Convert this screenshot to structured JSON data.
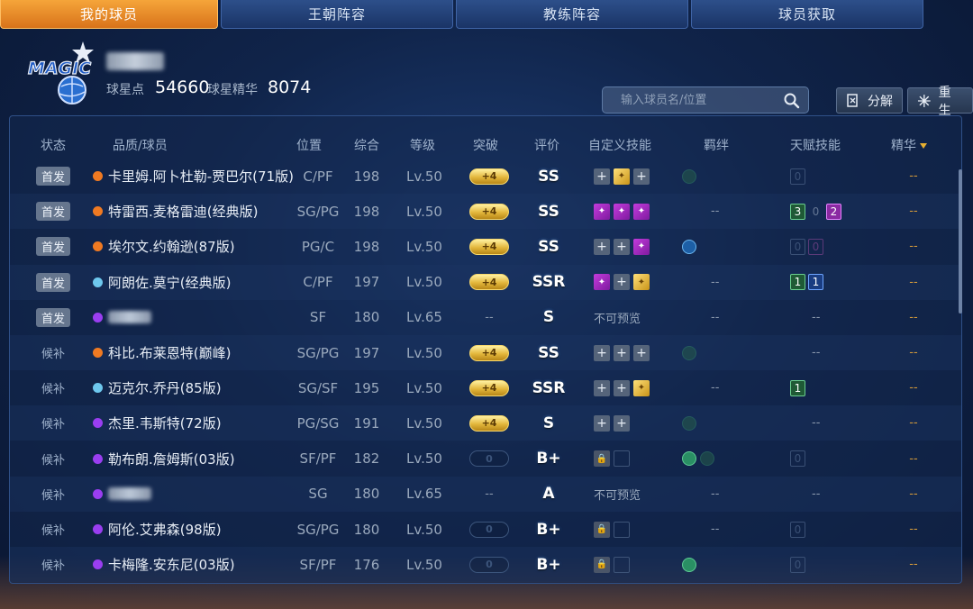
{
  "tabs": [
    "我的球员",
    "王朝阵容",
    "教练阵容",
    "球员获取"
  ],
  "profile": {
    "logo_text": "MAGIC",
    "star_points_label": "球星点",
    "star_points_value": "54660",
    "star_essence_label": "球星精华",
    "star_essence_value": "8074"
  },
  "search": {
    "placeholder": "输入球员名/位置",
    "icon": "search-icon"
  },
  "buttons": {
    "decompose": "分解",
    "rebirth": "重生"
  },
  "columns": [
    "状态",
    "品质/球员",
    "位置",
    "综合",
    "等级",
    "突破",
    "评价",
    "自定义技能",
    "羁绊",
    "天赋技能",
    "精华"
  ],
  "colors": {
    "orange": "#f07a22",
    "light_blue": "#6ec8ee",
    "purple": "#9a3ef0",
    "accent": "#e9962c"
  },
  "rows": [
    {
      "status": "首发",
      "starter": true,
      "quality": "orange",
      "name": "卡里姆.阿卜杜勒-贾巴尔(71版)",
      "position": "C/PF",
      "overall": "198",
      "level": "Lv.50",
      "breakthrough": "+4",
      "rating": "SS",
      "skills": [
        "plus",
        "skill-gold",
        "plus"
      ],
      "bonds": [
        "dim"
      ],
      "talents": [
        {
          "t": "empty",
          "v": "0"
        }
      ],
      "essence": "--"
    },
    {
      "status": "首发",
      "starter": true,
      "quality": "orange",
      "name": "特雷西.麦格雷迪(经典版)",
      "position": "SG/PG",
      "overall": "198",
      "level": "Lv.50",
      "breakthrough": "+4",
      "rating": "SS",
      "skills": [
        "skill-purple",
        "skill-purple",
        "skill-purple"
      ],
      "bonds": [],
      "bond_text": "--",
      "talents": [
        {
          "t": "green",
          "v": "3"
        },
        {
          "t": "plain",
          "v": "0"
        },
        {
          "t": "purple",
          "v": "2"
        }
      ],
      "essence": "--"
    },
    {
      "status": "首发",
      "starter": true,
      "quality": "orange",
      "name": "埃尔文.约翰逊(87版)",
      "position": "PG/C",
      "overall": "198",
      "level": "Lv.50",
      "breakthrough": "+4",
      "rating": "SS",
      "skills": [
        "plus",
        "plus",
        "skill-purple"
      ],
      "bonds": [
        "blue"
      ],
      "talents": [
        {
          "t": "empty",
          "v": "0"
        },
        {
          "t": "empty-purple",
          "v": "0"
        }
      ],
      "essence": "--"
    },
    {
      "status": "首发",
      "starter": true,
      "quality": "light_blue",
      "name": "阿朗佐.莫宁(经典版)",
      "position": "C/PF",
      "overall": "197",
      "level": "Lv.50",
      "breakthrough": "+4",
      "rating": "SSR",
      "skills": [
        "skill-purple",
        "plus",
        "skill-gold"
      ],
      "bonds": [],
      "bond_text": "--",
      "talents": [
        {
          "t": "green",
          "v": "1"
        },
        {
          "t": "blue",
          "v": "1"
        }
      ],
      "essence": "--"
    },
    {
      "status": "首发",
      "starter": true,
      "quality": "purple",
      "name": "",
      "blurred": true,
      "position": "SF",
      "overall": "180",
      "level": "Lv.65",
      "breakthrough": "",
      "bt_text": "--",
      "rating": "S",
      "skills": [],
      "skills_text": "不可预览",
      "bonds": [],
      "bond_text": "--",
      "talents": [],
      "talent_text": "--",
      "essence": "--"
    },
    {
      "status": "候补",
      "starter": false,
      "quality": "orange",
      "name": "科比.布莱恩特(巅峰)",
      "position": "SG/PG",
      "overall": "197",
      "level": "Lv.50",
      "breakthrough": "+4",
      "rating": "SS",
      "skills": [
        "plus",
        "plus",
        "plus"
      ],
      "bonds": [
        "dim"
      ],
      "talents": [],
      "talent_text": "--",
      "essence": "--"
    },
    {
      "status": "候补",
      "starter": false,
      "quality": "light_blue",
      "name": "迈克尔.乔丹(85版)",
      "position": "SG/SF",
      "overall": "195",
      "level": "Lv.50",
      "breakthrough": "+4",
      "rating": "SSR",
      "skills": [
        "plus",
        "plus",
        "skill-gold"
      ],
      "bonds": [],
      "bond_text": "--",
      "talents": [
        {
          "t": "green",
          "v": "1"
        }
      ],
      "essence": "--"
    },
    {
      "status": "候补",
      "starter": false,
      "quality": "purple",
      "name": "杰里.韦斯特(72版)",
      "position": "PG/SG",
      "overall": "191",
      "level": "Lv.50",
      "breakthrough": "+4",
      "rating": "S",
      "skills": [
        "plus",
        "plus"
      ],
      "bonds": [
        "dim"
      ],
      "talents": [],
      "talent_text": "--",
      "essence": "--"
    },
    {
      "status": "候补",
      "starter": false,
      "quality": "purple",
      "name": "勒布朗.詹姆斯(03版)",
      "position": "SF/PF",
      "overall": "182",
      "level": "Lv.50",
      "breakthrough": "0",
      "rating": "B+",
      "skills": [
        "lock",
        "blank"
      ],
      "bonds": [
        "green",
        "dim"
      ],
      "talents": [
        {
          "t": "empty",
          "v": "0"
        }
      ],
      "essence": "--"
    },
    {
      "status": "候补",
      "starter": false,
      "quality": "purple",
      "name": "",
      "blurred": true,
      "position": "SG",
      "overall": "180",
      "level": "Lv.65",
      "breakthrough": "",
      "bt_text": "--",
      "rating": "A",
      "skills": [],
      "skills_text": "不可预览",
      "bonds": [],
      "bond_text": "--",
      "talents": [],
      "talent_text": "--",
      "essence": "--"
    },
    {
      "status": "候补",
      "starter": false,
      "quality": "purple",
      "name": "阿伦.艾弗森(98版)",
      "position": "SG/PG",
      "overall": "180",
      "level": "Lv.50",
      "breakthrough": "0",
      "rating": "B+",
      "skills": [
        "lock",
        "blank"
      ],
      "bonds": [],
      "bond_text": "--",
      "talents": [
        {
          "t": "empty",
          "v": "0"
        }
      ],
      "essence": "--"
    },
    {
      "status": "候补",
      "starter": false,
      "quality": "purple",
      "name": "卡梅隆.安东尼(03版)",
      "position": "SF/PF",
      "overall": "176",
      "level": "Lv.50",
      "breakthrough": "0",
      "rating": "B+",
      "skills": [
        "lock",
        "blank"
      ],
      "bonds": [
        "green"
      ],
      "talents": [
        {
          "t": "empty",
          "v": "0"
        }
      ],
      "essence": "--"
    }
  ]
}
